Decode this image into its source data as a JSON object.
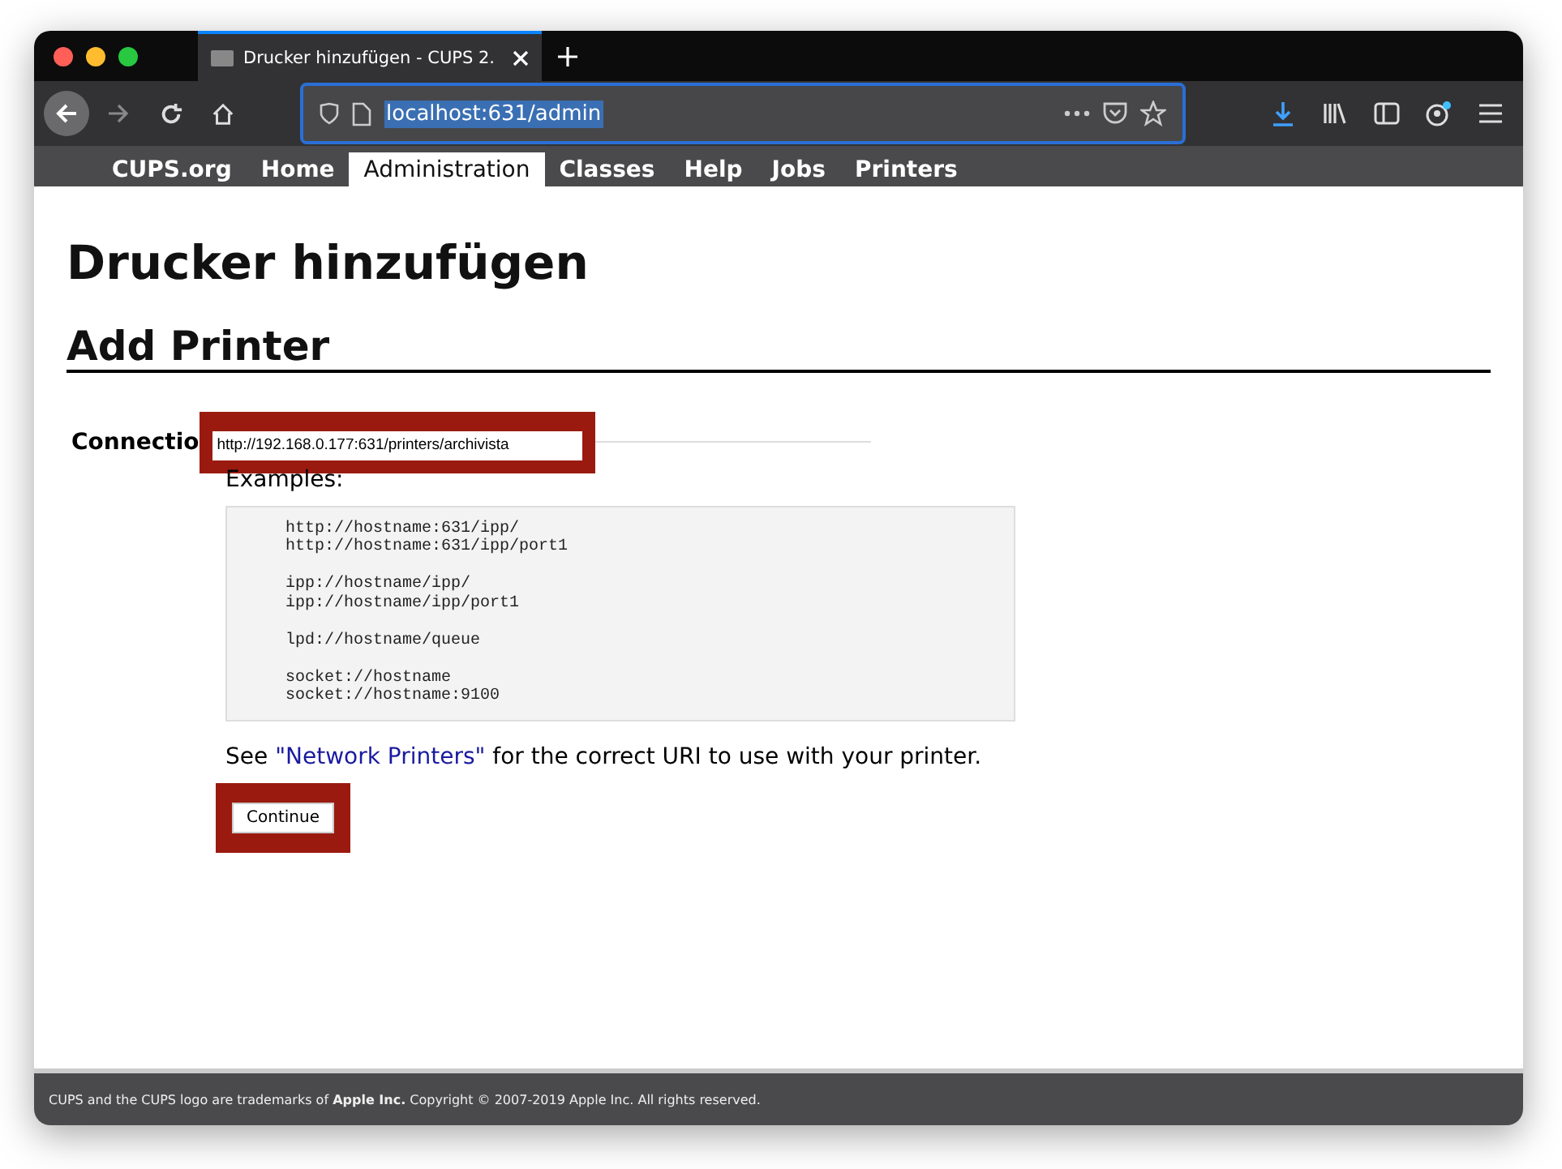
{
  "window": {
    "tab_title": "Drucker hinzufügen - CUPS 2.",
    "address": "localhost:631/admin"
  },
  "nav": [
    {
      "label": "CUPS.org",
      "selected": false
    },
    {
      "label": "Home",
      "selected": false
    },
    {
      "label": "Administration",
      "selected": true
    },
    {
      "label": "Classes",
      "selected": false
    },
    {
      "label": "Help",
      "selected": false
    },
    {
      "label": "Jobs",
      "selected": false
    },
    {
      "label": "Printers",
      "selected": false
    }
  ],
  "page": {
    "title": "Drucker hinzufügen",
    "subtitle": "Add Printer",
    "connection_label": "Connectio",
    "connection_value": "http://192.168.0.177:631/printers/archivista",
    "examples_label": "Examples:",
    "examples": "http://hostname:631/ipp/\nhttp://hostname:631/ipp/port1\n\nipp://hostname/ipp/\nipp://hostname/ipp/port1\n\nlpd://hostname/queue\n\nsocket://hostname\nsocket://hostname:9100",
    "hint_before": "See ",
    "hint_link": "\"Network Printers\"",
    "hint_after": " for the correct URI to use with your printer.",
    "continue": "Continue"
  },
  "footer": "CUPS and the CUPS logo are trademarks of **Apple Inc.** Copyright © 2007-2019 Apple Inc. All rights reserved."
}
